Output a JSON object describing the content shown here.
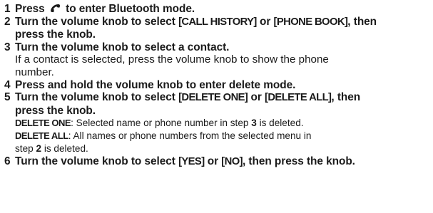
{
  "top_fragment": "· · ·",
  "steps": [
    {
      "num": "1",
      "before_icon": "Press ",
      "icon": "phone-icon",
      "after_icon": " to enter Bluetooth mode."
    },
    {
      "num": "2",
      "text_a": "Turn the volume knob to select ",
      "opt1": "[CALL HISTORY]",
      "text_b": " or ",
      "opt2": "[PHONE BOOK]",
      "text_c": ", then",
      "text_d": "press the knob."
    },
    {
      "num": "3",
      "text": "Turn the volume knob to select a contact.",
      "note_line1": "If a contact is selected, press the volume knob to show the phone",
      "note_line2": "number."
    },
    {
      "num": "4",
      "text": "Press and hold the volume knob to enter delete mode."
    },
    {
      "num": "5",
      "text_a": "Turn the volume knob to select ",
      "opt1": "[DELETE ONE]",
      "text_b": " or ",
      "opt2": "[DELETE ALL]",
      "text_c": ", then",
      "text_d": "press the knob.",
      "def1_term": "DELETE ONE",
      "def1_a": ": Selected name or phone number in step ",
      "def1_step": "3",
      "def1_b": " is deleted.",
      "def2_term": "DELETE ALL",
      "def2_a": ": All names or phone numbers from the selected menu in",
      "def2_b": "step ",
      "def2_step": "2",
      "def2_c": " is deleted."
    },
    {
      "num": "6",
      "text_a": "Turn the volume knob to select ",
      "opt1": "[YES]",
      "text_b": " or ",
      "opt2": "[NO]",
      "text_c": ", then press the knob."
    }
  ]
}
